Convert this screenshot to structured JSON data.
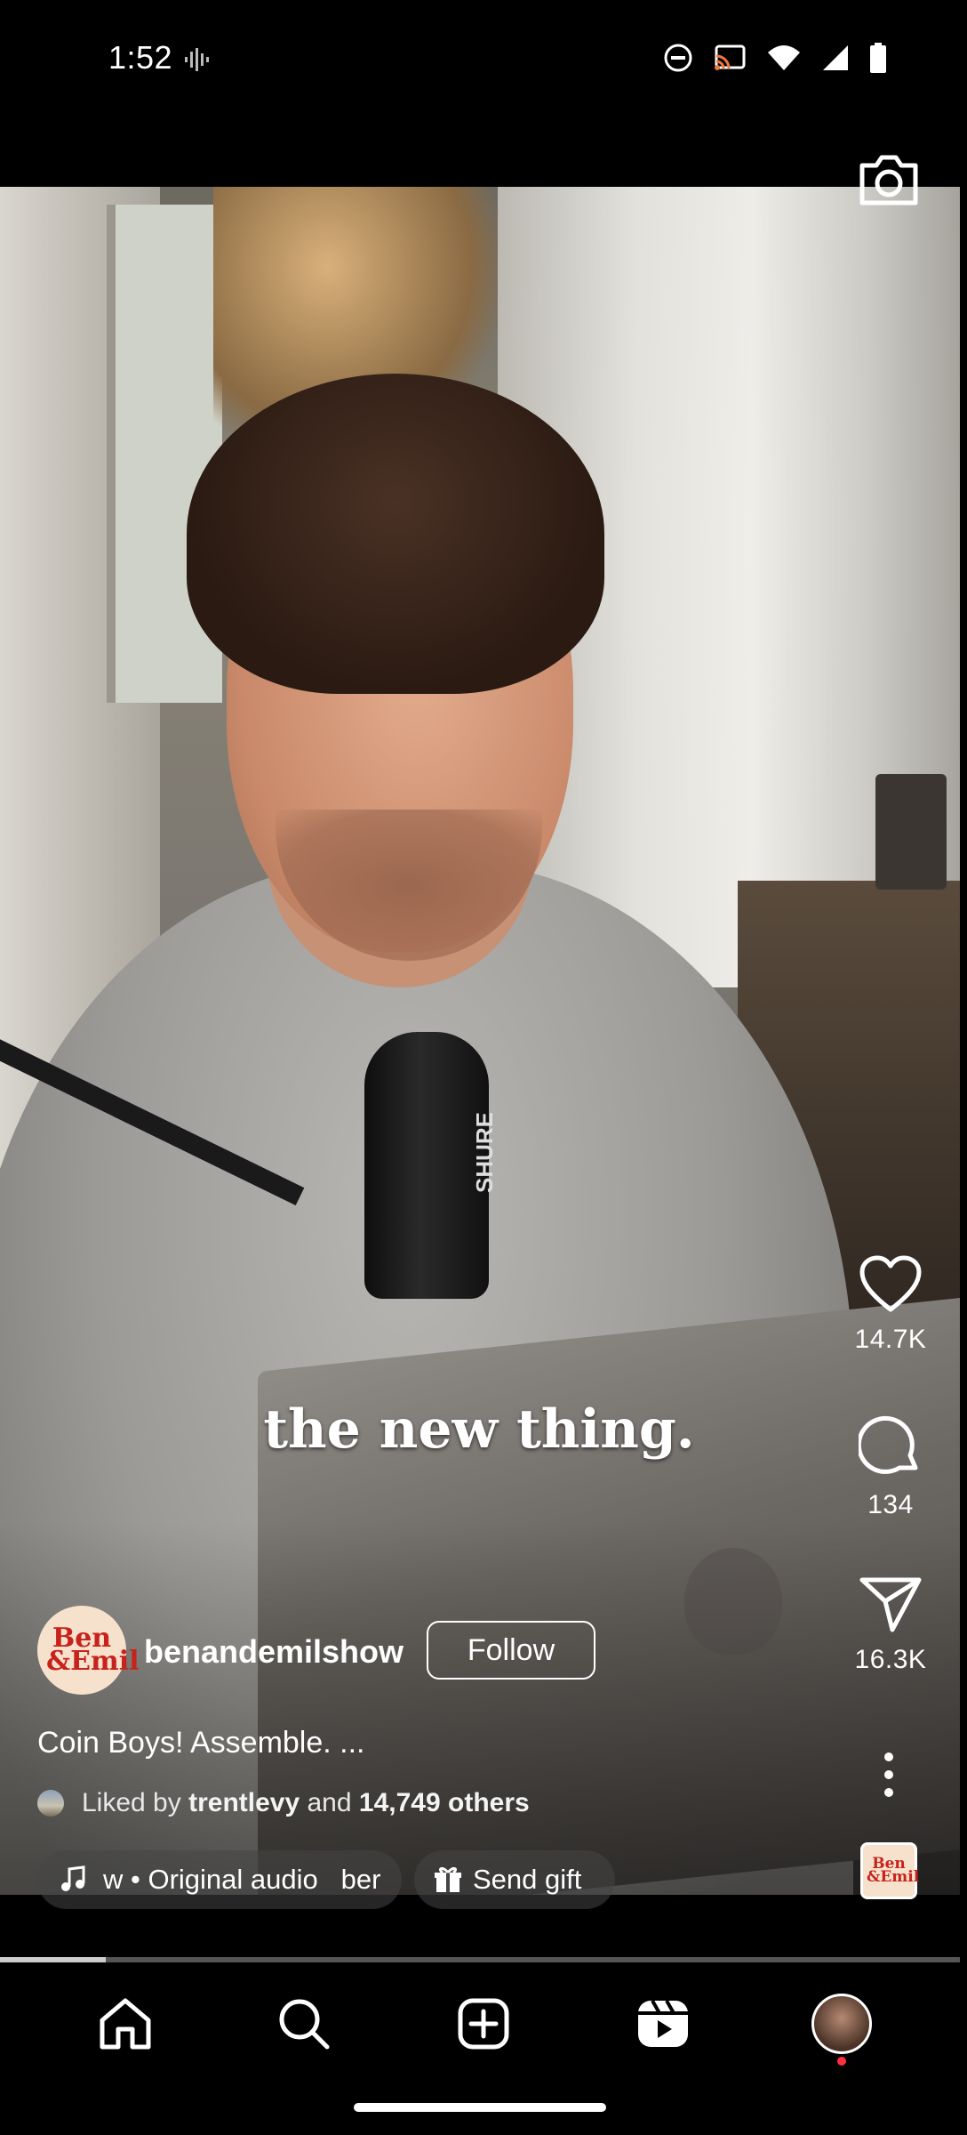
{
  "status_bar": {
    "time": "1:52"
  },
  "reel": {
    "caption_overlay": "the new thing.",
    "mic_brand": "SHURE",
    "username": "benandemilshow",
    "profile_logo": "Ben &Emil",
    "follow_label": "Follow",
    "description": "Coin Boys! Assemble. ...",
    "liked_by_prefix": "Liked by",
    "liked_by_user": "trentlevy",
    "liked_by_mid": "and",
    "liked_by_others": "14,749 others",
    "audio_label": "w • Original audio   ber",
    "gift_label": "Send gift",
    "progress": 0.11
  },
  "actions": {
    "likes": "14.7K",
    "comments": "134",
    "shares": "16.3K"
  },
  "nav": {
    "items": [
      "home-icon",
      "search-icon",
      "create-icon",
      "reels-icon",
      "profile-avatar"
    ]
  },
  "colors": {
    "notification_dot": "#ff3040",
    "logo_red": "#c8221c"
  }
}
